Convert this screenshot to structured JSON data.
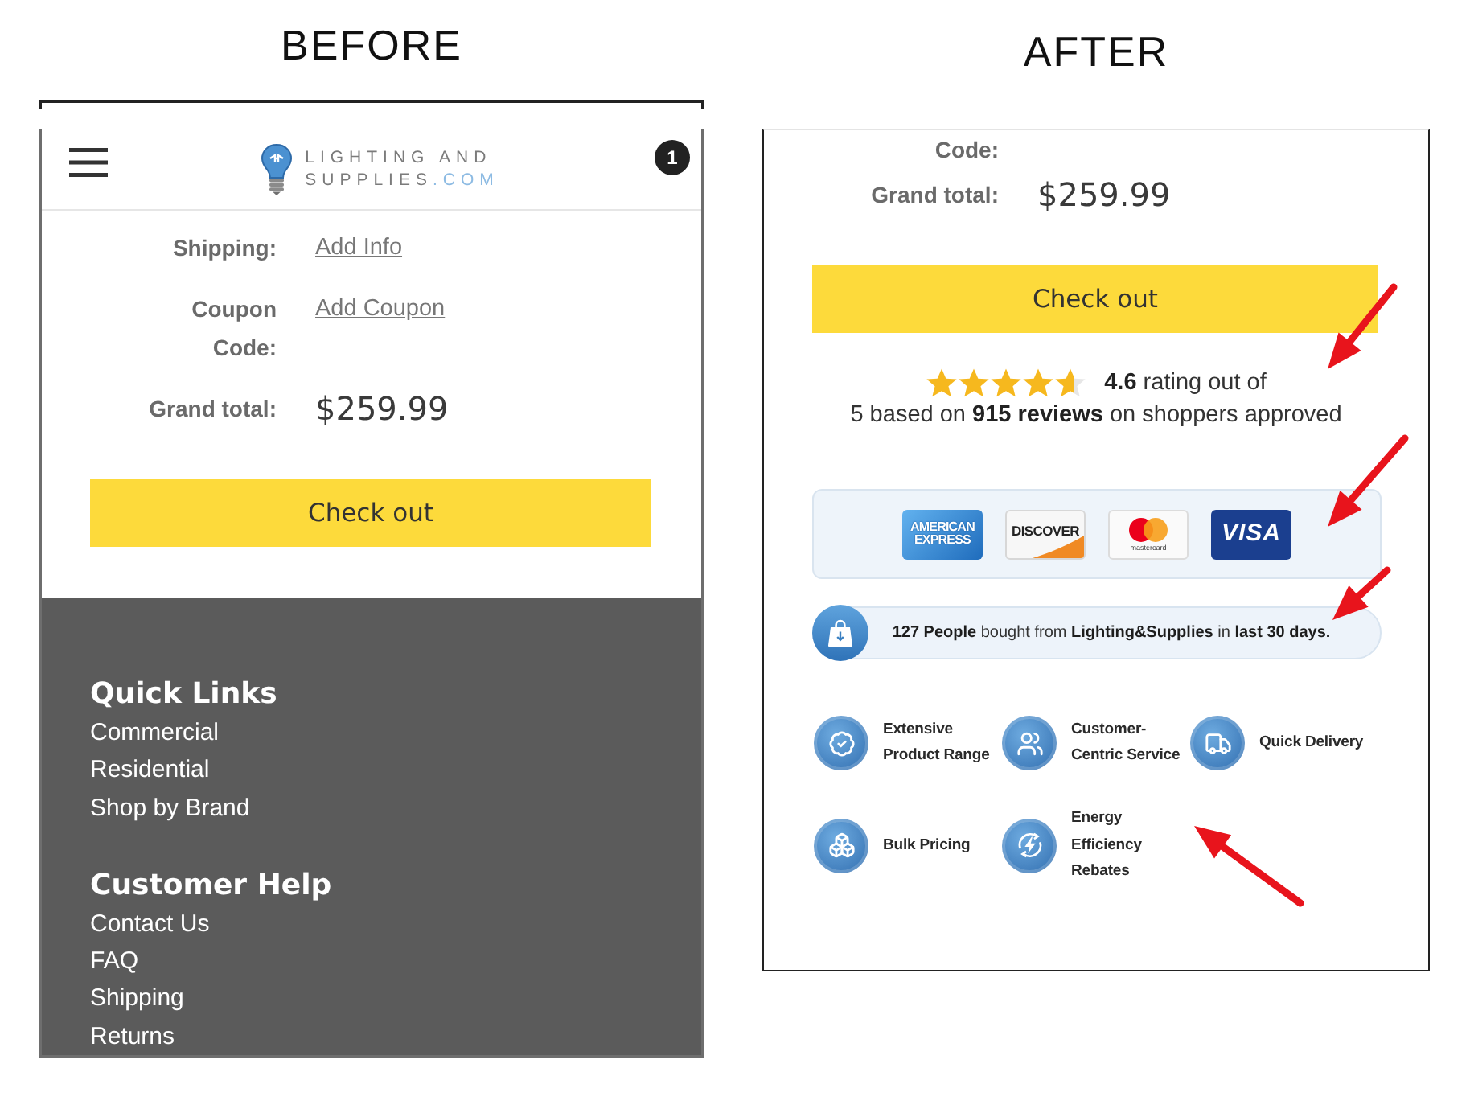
{
  "before": {
    "heading": "BEFORE",
    "header": {
      "logo": {
        "lines": [
          "LIGHTING AND",
          "SUPPLIES"
        ],
        "suffix": ".COM"
      },
      "cart_count": "1"
    },
    "summary_rows": [
      {
        "label": "Shipping:",
        "link": "Add Info"
      },
      {
        "label": "Coupon Code:",
        "link": "Add Coupon"
      },
      {
        "label": "Grand total:",
        "value": "$259.99"
      }
    ],
    "checkout_button": "Check out",
    "footer": {
      "sections": [
        {
          "title": "Quick Links",
          "links": [
            "Commercial",
            "Residential",
            "Shop by Brand"
          ]
        },
        {
          "title": "Customer Help",
          "links": [
            "Contact Us",
            "FAQ",
            "Shipping",
            "Returns"
          ]
        }
      ]
    }
  },
  "after": {
    "heading": "AFTER",
    "summary_rows": [
      {
        "label": "Code:"
      },
      {
        "label": "Grand total:",
        "value": "$259.99"
      }
    ],
    "checkout_button": "Check out",
    "rating": {
      "stars": 4.6,
      "score_line": "**4.6** rating out of",
      "detail_line": "5 based on **915 reviews** on shoppers approved"
    },
    "payment_cards": [
      {
        "kind": "amex",
        "label": "AMERICAN EXPRESS"
      },
      {
        "kind": "discover",
        "label": "DISCOVER"
      },
      {
        "kind": "mastercard",
        "label": "mastercard"
      },
      {
        "kind": "visa",
        "label": "VISA"
      }
    ],
    "purchase_notice": "**127 People** bought from **Lighting&Supplies** in **last 30 days.**",
    "features": [
      {
        "kind": "range",
        "label": "Extensive Product Range"
      },
      {
        "kind": "service",
        "label": "Customer-Centric Service"
      },
      {
        "kind": "delivery",
        "label": "Quick Delivery"
      },
      {
        "kind": "bulk",
        "label": "Bulk Pricing"
      },
      {
        "kind": "energy",
        "label": "Energy Efficiency Rebates"
      }
    ]
  }
}
